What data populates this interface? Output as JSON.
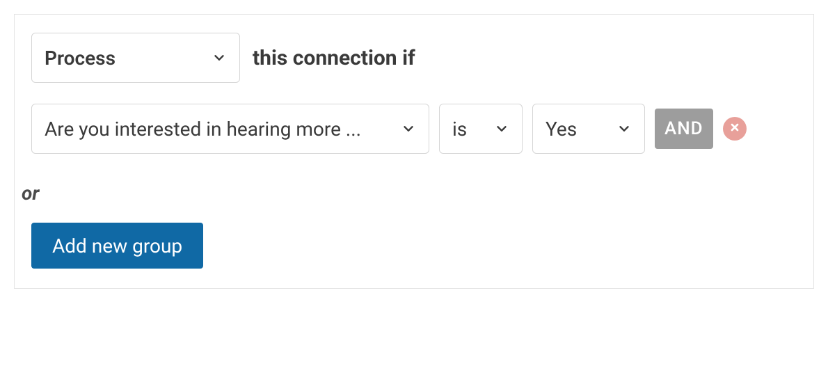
{
  "condition": {
    "action": "Process",
    "label": "this connection if",
    "rule": {
      "field": "Are you interested in hearing more ...",
      "operator": "is",
      "value": "Yes",
      "joiner": "AND"
    },
    "or_label": "or",
    "add_group_label": "Add new group"
  }
}
